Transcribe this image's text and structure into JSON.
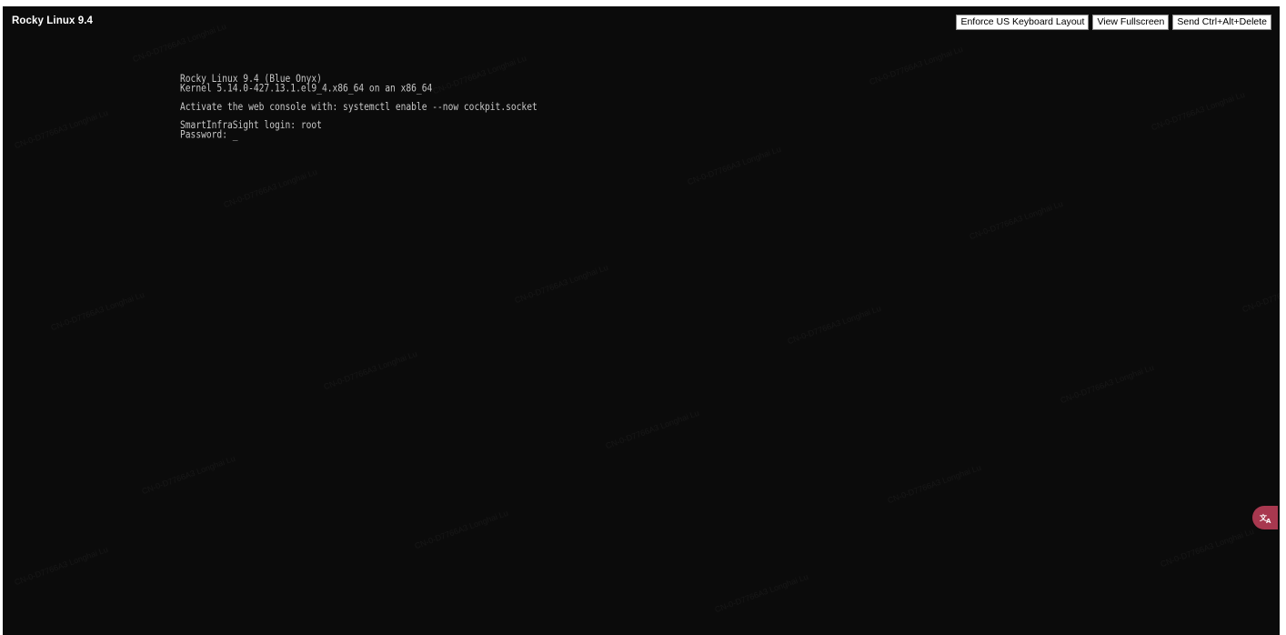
{
  "window": {
    "title": "Rocky Linux 9.4"
  },
  "toolbar": {
    "enforce_keyboard_label": "Enforce US Keyboard Layout",
    "fullscreen_label": "View Fullscreen",
    "ctrl_alt_del_label": "Send Ctrl+Alt+Delete"
  },
  "console": {
    "lines": [
      "Rocky Linux 9.4 (Blue Onyx)",
      "Kernel 5.14.0-427.13.1.el9_4.x86_64 on an x86_64",
      "",
      "Activate the web console with: systemctl enable --now cockpit.socket",
      "",
      "SmartInfraSight login: root",
      "Password: "
    ],
    "cursor": "_"
  },
  "translate_badge": {
    "icon": "translate-icon",
    "color": "#a8384f"
  },
  "watermark": {
    "text": "CN-0-D7766A3 Longhai Lu"
  }
}
